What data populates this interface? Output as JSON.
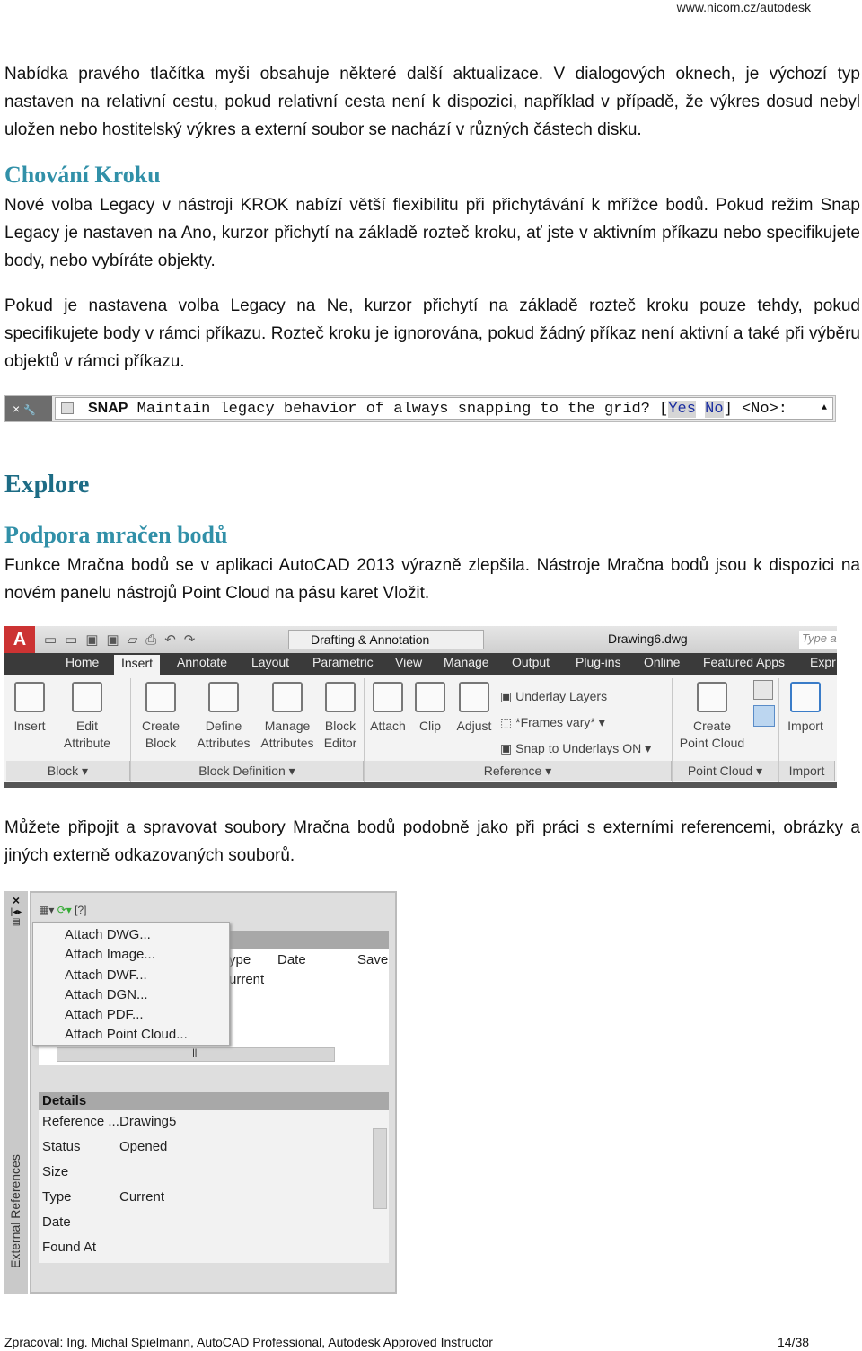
{
  "header": {
    "url": "www.nicom.cz/autodesk"
  },
  "paragraphs": {
    "p1": "Nabídka pravého tlačítka myši obsahuje některé další aktualizace. V dialogových oknech, je výchozí typ nastaven na relativní cestu, pokud relativní cesta není k dispozici, například v případě, že výkres dosud nebyl uložen nebo hostitelský výkres a externí soubor se nachází v různých částech disku.",
    "h_snap": "Chování Kroku",
    "p2": "Nové volba Legacy v nástroji KROK nabízí větší flexibilitu při přichytávání k mřížce bodů. Pokud režim Snap Legacy je nastaven na Ano, kurzor přichytí na základě rozteč kroku, ať jste v aktivním příkazu nebo specifikujete body, nebo vybíráte objekty.",
    "p3": "Pokud je nastavena volba Legacy na Ne, kurzor přichytí na základě rozteč kroku pouze tehdy, pokud specifikujete body v rámci příkazu. Rozteč kroku je ignorována, pokud žádný příkaz není aktivní a také při výběru objektů v rámci příkazu.",
    "h_explore": "Explore",
    "h_pc": "Podpora mračen bodů",
    "p4": "Funkce Mračna bodů se v aplikaci AutoCAD 2013 výrazně zlepšila. Nástroje Mračna bodů jsou k dispozici na novém panelu nástrojů Point Cloud na pásu karet Vložit.",
    "p5": "Můžete připojit a spravovat soubory Mračna bodů podobně jako při práci s externími referencemi, obrázky a jiných externě odkazovaných souborů."
  },
  "command_line": {
    "command": "SNAP",
    "prompt": "Maintain legacy behavior of always snapping to the grid? [",
    "opt_yes": "Yes",
    "opt_no": "No",
    "suffix": "] <No>:",
    "close": "×",
    "wrench": "🔧"
  },
  "ribbon": {
    "workspace": "Drafting & Annotation",
    "title": "Drawing6.dwg",
    "search_placeholder": "Type a",
    "tabs": [
      "Home",
      "Insert",
      "Annotate",
      "Layout",
      "Parametric",
      "View",
      "Manage",
      "Output",
      "Plug-ins",
      "Online",
      "Featured Apps",
      "Expr"
    ],
    "active_tab": "Insert",
    "buttons": {
      "insert": "Insert",
      "edit_attr": [
        "Edit",
        "Attribute"
      ],
      "create_block": [
        "Create",
        "Block"
      ],
      "define_attr": [
        "Define",
        "Attributes"
      ],
      "manage_attr": [
        "Manage",
        "Attributes"
      ],
      "block_editor": [
        "Block",
        "Editor"
      ],
      "attach": "Attach",
      "clip": "Clip",
      "adjust": "Adjust",
      "underlay_layers": "Underlay Layers",
      "frames": "*Frames vary*",
      "snap_underlays": "Snap to Underlays ON",
      "create_pc": [
        "Create",
        "Point Cloud"
      ],
      "import": "Import"
    },
    "panels": [
      "Block",
      "Block Definition",
      "Reference",
      "Point Cloud",
      "Import"
    ]
  },
  "xref": {
    "palette_title": "External References",
    "menu": [
      "Attach DWG...",
      "Attach Image...",
      "Attach DWF...",
      "Attach DGN...",
      "Attach PDF...",
      "Attach Point Cloud..."
    ],
    "columns": [
      "ype",
      "Date",
      "Save"
    ],
    "row_type": "urrent",
    "details_title": "Details",
    "details": [
      [
        "Reference ...",
        "Drawing5"
      ],
      [
        "Status",
        "Opened"
      ],
      [
        "Size",
        ""
      ],
      [
        "Type",
        "Current"
      ],
      [
        "Date",
        ""
      ],
      [
        "Found At",
        ""
      ]
    ]
  },
  "footer": {
    "author": "Zpracoval: Ing. Michal Spielmann, AutoCAD Professional, Autodesk Approved Instructor",
    "page": "14/38"
  },
  "colors": {
    "heading": "#3190a8",
    "heading_dark": "#1d6c85",
    "ribbon_tabs": "#3a3a3a"
  }
}
